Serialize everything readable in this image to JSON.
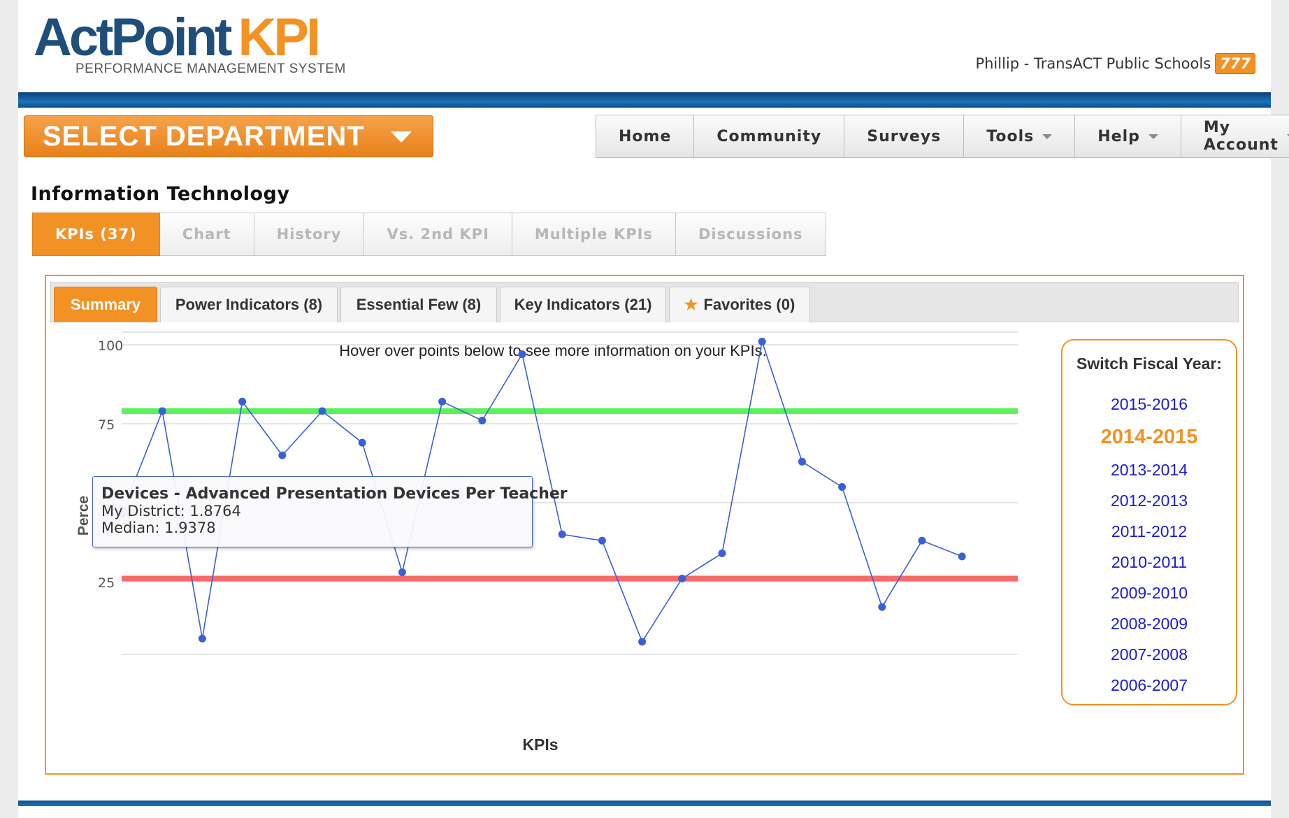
{
  "header": {
    "logo_main": "ActPoint",
    "logo_kpi": "KPI",
    "logo_sub": "PERFORMANCE MANAGEMENT SYSTEM",
    "user_label": "Phillip - TransACT Public Schools",
    "user_badge": "777"
  },
  "department_selector": {
    "label": "SELECT DEPARTMENT"
  },
  "main_nav": [
    {
      "label": "Home",
      "has_dropdown": false
    },
    {
      "label": "Community",
      "has_dropdown": false
    },
    {
      "label": "Surveys",
      "has_dropdown": false
    },
    {
      "label": "Tools",
      "has_dropdown": true
    },
    {
      "label": "Help",
      "has_dropdown": true
    },
    {
      "label": "My Account",
      "has_dropdown": true
    }
  ],
  "department_title": "Information Technology",
  "tabs": [
    "KPIs (37)",
    "Chart",
    "History",
    "Vs. 2nd KPI",
    "Multiple KPIs",
    "Discussions"
  ],
  "active_tab": "KPIs (37)",
  "subtabs": [
    "Summary",
    "Power Indicators (8)",
    "Essential Few (8)",
    "Key Indicators (21)",
    "Favorites (0)"
  ],
  "active_subtab": "Summary",
  "hover_hint": "Hover over points below to see more information on your KPIs.",
  "fiscal_year": {
    "title": "Switch Fiscal Year:",
    "years": [
      "2015-2016",
      "2014-2015",
      "2013-2014",
      "2012-2013",
      "2011-2012",
      "2010-2011",
      "2009-2010",
      "2008-2009",
      "2007-2008",
      "2006-2007"
    ],
    "current": "2014-2015"
  },
  "tooltip": {
    "title": "Devices - Advanced Presentation Devices Per Teacher",
    "my_district": "My District: 1.8764",
    "median": "Median: 1.9378"
  },
  "colors": {
    "accent": "#f39224",
    "brand_blue": "#1f4e79",
    "series": "#3a5fd9",
    "target_line": "#5cf05c",
    "floor_line": "#f86a6a",
    "link": "#1a1ad8"
  },
  "chart_data": {
    "type": "line",
    "xlabel": "KPIs",
    "ylabel": "Perce",
    "ytick_labels": [
      "25",
      "50",
      "75",
      "100"
    ],
    "yticks": [
      25,
      50,
      75,
      100
    ],
    "ylim": [
      2,
      104
    ],
    "series": [
      {
        "values": [
          47,
          79,
          7,
          82,
          65,
          79,
          69,
          28,
          82,
          76,
          97,
          40,
          38,
          6,
          26,
          34,
          101,
          63,
          55,
          17,
          38,
          33
        ]
      }
    ],
    "reference_lines": [
      {
        "value": 79,
        "color": "#5cf05c"
      },
      {
        "value": 26,
        "color": "#f86a6a"
      }
    ],
    "grid": true
  }
}
